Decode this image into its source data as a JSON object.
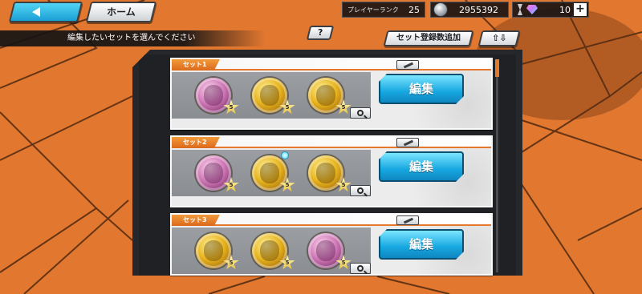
{
  "topbar": {
    "home_label": "ホーム",
    "player_rank_label": "プレイヤーランク",
    "player_rank_value": "25",
    "coins": "2955392",
    "gems": "10",
    "add_label": "+"
  },
  "instruction": "編集したいセットを選んでください",
  "help_label": "?",
  "add_set_label": "セット登録数追加",
  "sort_label": "⇧⇩",
  "edit_label": "編集",
  "sets": [
    {
      "name": "セット1",
      "medals": [
        {
          "color": "pink",
          "stars": "5"
        },
        {
          "color": "gold",
          "stars": "5"
        },
        {
          "color": "gold",
          "stars": "5"
        }
      ]
    },
    {
      "name": "セット2",
      "medals": [
        {
          "color": "pink",
          "stars": "5"
        },
        {
          "color": "gold",
          "stars": "5",
          "gem": true
        },
        {
          "color": "gold",
          "stars": "5"
        }
      ]
    },
    {
      "name": "セット3",
      "medals": [
        {
          "color": "gold",
          "stars": "5"
        },
        {
          "color": "gold",
          "stars": "5"
        },
        {
          "color": "pink",
          "stars": "5"
        }
      ]
    }
  ],
  "colors": {
    "accent_orange": "#e6782d",
    "edit_button_blue": "#17a7e0",
    "panel_dark": "#26272a"
  }
}
